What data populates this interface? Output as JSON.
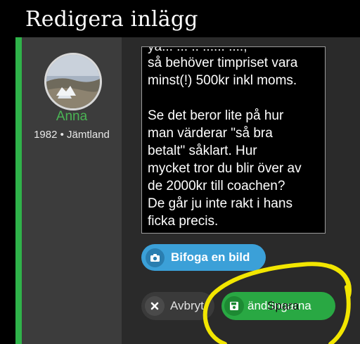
{
  "header": {
    "title": "Redigera inlägg"
  },
  "author": {
    "name": "Anna",
    "meta": "1982 • Jämtland"
  },
  "editor": {
    "cut_line": "ya... ... .. ...... ....,",
    "lines_1": [
      "så behöver timpriset vara",
      "minst(!) 500kr inkl moms."
    ],
    "lines_2": [
      "Se det beror lite på hur",
      "man värderar \"så bra",
      "betalt\" såklart. Hur",
      "mycket tror du blir över av",
      "de 2000kr till coachen?",
      "De går ju inte rakt i hans",
      "ficka precis."
    ]
  },
  "buttons": {
    "attach_label": "Bifoga en bild",
    "cancel_label": "Avbryt",
    "save_label": "ändringarna",
    "save_overlay": "Spara"
  },
  "icons": {
    "attach": "camera-icon",
    "cancel": "close-icon",
    "save": "floppy-disk-icon"
  },
  "colors": {
    "accent": "#2fb34a",
    "attach_button": "#3ba0d8",
    "save_button": "#29a843",
    "annotation": "#f2e600"
  }
}
